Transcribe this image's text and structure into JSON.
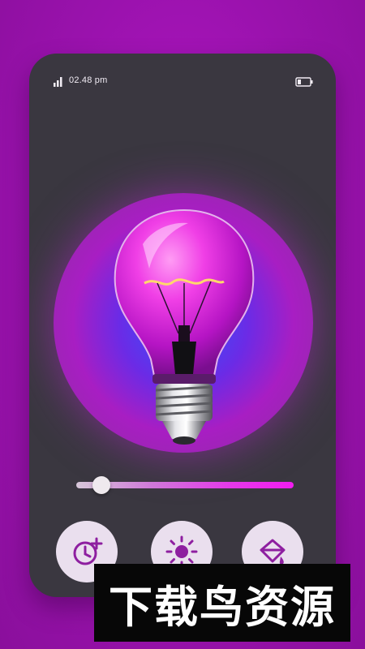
{
  "status_bar": {
    "time": "02.48 pm",
    "signal_icon": "signal-bars-icon",
    "battery_icon": "battery-low-icon"
  },
  "bulb": {
    "icon": "light-bulb-icon"
  },
  "brightness_slider": {
    "value_fraction": 0.08
  },
  "controls": [
    {
      "icon": "timer-add-icon"
    },
    {
      "icon": "brightness-sun-icon"
    },
    {
      "icon": "paint-bucket-icon"
    }
  ],
  "watermark": {
    "text": "下载鸟资源"
  },
  "colors": {
    "background": "#9a12ad",
    "phone": "#3a3740",
    "accent": "#f21cf0",
    "button_bg": "#eadfee"
  }
}
